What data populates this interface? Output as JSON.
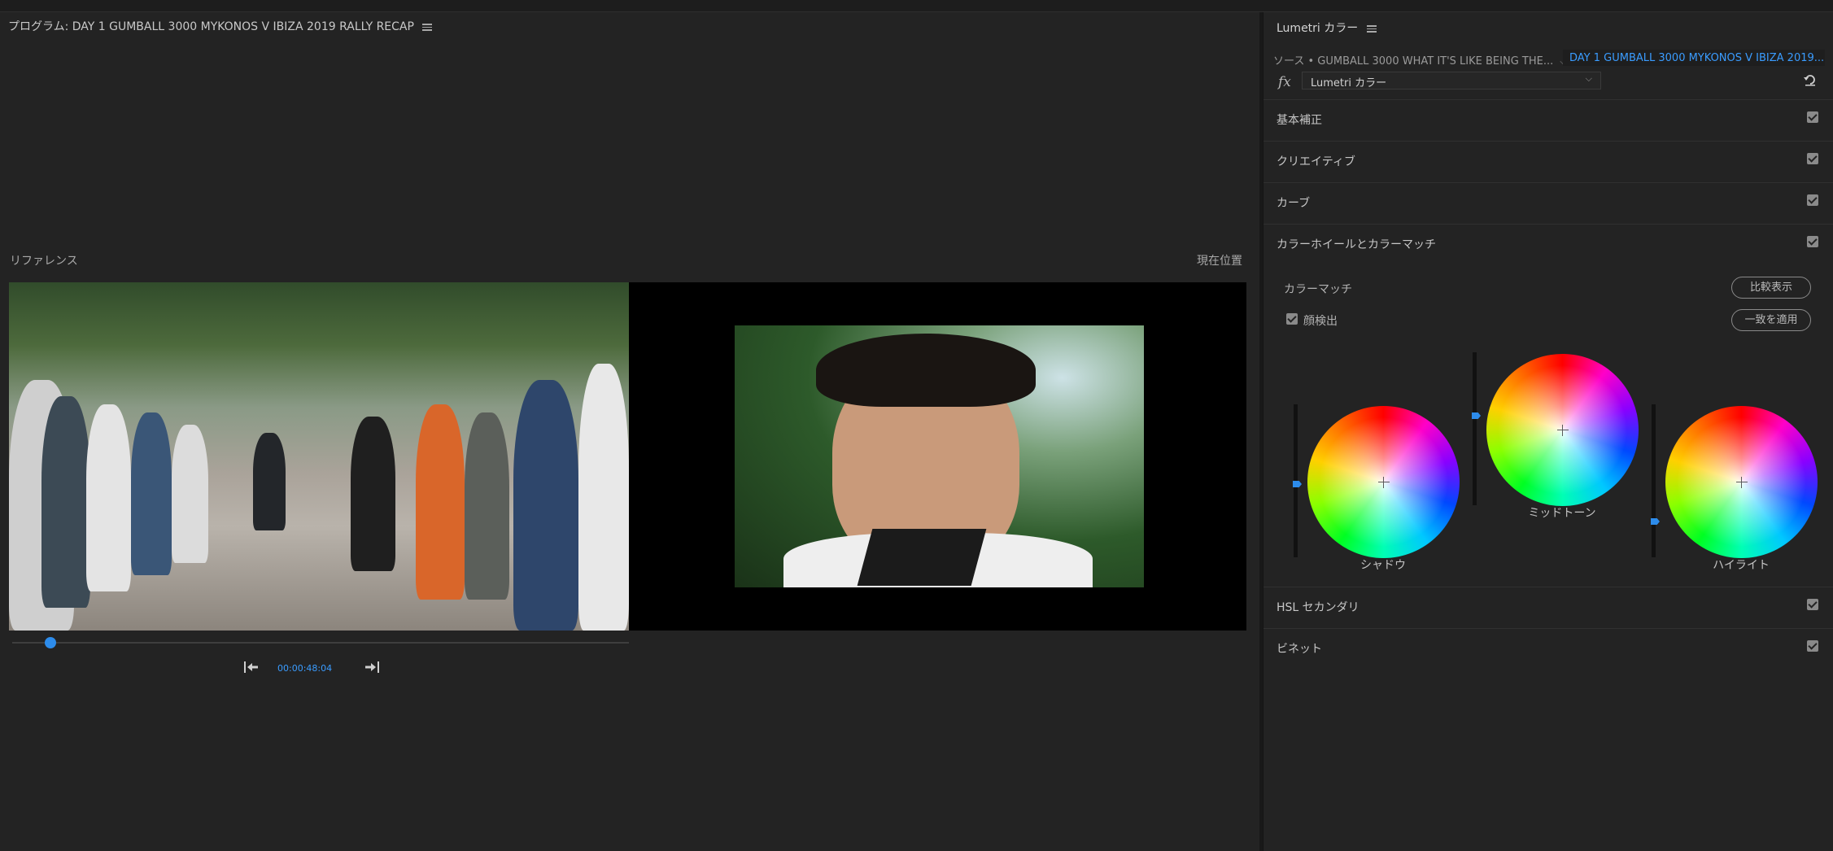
{
  "program": {
    "title": "プログラム: DAY 1 GUMBALL 3000 MYKONOS V IBIZA 2019 RALLY RECAP",
    "reference_label": "リファレンス",
    "current_label": "現在位置",
    "timecode": "00:00:48:04",
    "scrub_position": 0.05
  },
  "lumetri": {
    "title": "Lumetri カラー",
    "source_tab": "ソース • GUMBALL 3000 WHAT IT'S LIKE BEING THE...",
    "sequence_tab": "DAY 1 GUMBALL 3000 MYKONOS V IBIZA 2019...",
    "fx_label": "fx",
    "effect": "Lumetri カラー",
    "sections": [
      {
        "label": "基本補正",
        "checked": true
      },
      {
        "label": "クリエイティブ",
        "checked": true
      },
      {
        "label": "カーブ",
        "checked": true
      },
      {
        "label": "カラーホイールとカラーマッチ",
        "checked": true
      },
      {
        "label": "HSL セカンダリ",
        "checked": true
      },
      {
        "label": "ビネット",
        "checked": true
      }
    ],
    "color_match": {
      "label": "カラーマッチ",
      "face_detect_label": "顔検出",
      "face_detect_checked": true,
      "compare_button": "比較表示",
      "apply_button": "一致を適用"
    },
    "wheels": {
      "shadow": "シャドウ",
      "midtone": "ミッドトーン",
      "highlight": "ハイライト"
    }
  },
  "colors": {
    "accent": "#2d8ceb",
    "timecode": "#3a9cff",
    "panel_bg": "#232323"
  }
}
